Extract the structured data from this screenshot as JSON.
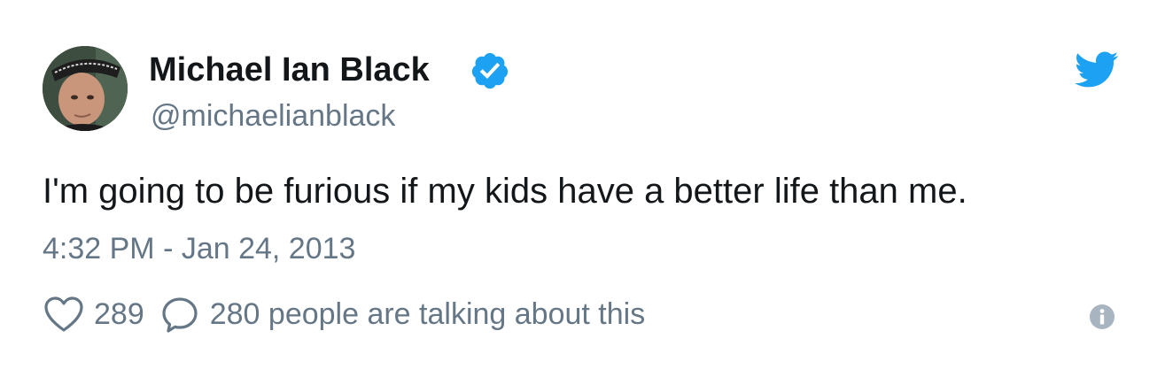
{
  "tweet": {
    "author": {
      "name": "Michael Ian Black",
      "handle": "@michaelianblack",
      "verified": true
    },
    "text": "I'm going to be furious if my kids have a better life than me.",
    "timestamp": "4:32 PM - Jan 24, 2013",
    "actions": {
      "like_count": "289",
      "talking_text": "280 people are talking about this"
    }
  },
  "icons": {
    "verified": "verified-badge-icon",
    "brand": "twitter-bird-icon",
    "like": "heart-icon",
    "reply": "speech-bubble-icon",
    "info": "info-icon"
  },
  "colors": {
    "twitter_blue": "#1DA1F2",
    "text_primary": "#14171a",
    "text_secondary": "#657786"
  }
}
